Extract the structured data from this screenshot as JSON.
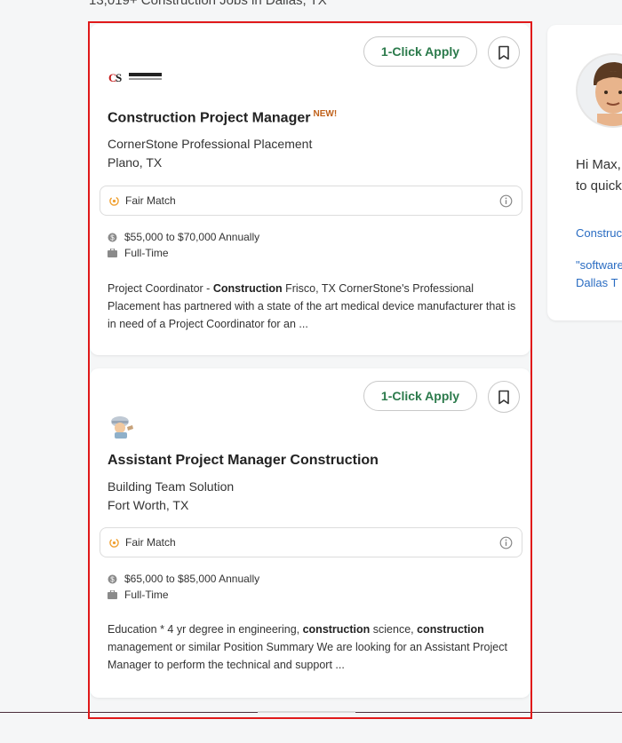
{
  "header": {
    "results_count": "13,019+ Construction Jobs in Dallas, TX"
  },
  "jobs": [
    {
      "apply_label": "1-Click Apply",
      "title": "Construction Project Manager",
      "new_badge": "NEW!",
      "company": "CornerStone Professional Placement",
      "location": "Plano, TX",
      "match_label": "Fair Match",
      "salary": "$55,000 to $70,000 Annually",
      "job_type": "Full-Time",
      "desc": [
        "Project Coordinator - ",
        "Construction",
        " Frisco, TX CornerStone's Professional Placement has partnered with a state of the art medical device manufacturer that is in need of a Project Coordinator for an ..."
      ],
      "logo_text": "CornerStone"
    },
    {
      "apply_label": "1-Click Apply",
      "title": "Assistant Project Manager Construction",
      "company": "Building Team Solution",
      "location": "Fort Worth, TX",
      "match_label": "Fair Match",
      "salary": "$65,000 to $85,000 Annually",
      "job_type": "Full-Time",
      "desc": [
        "Education * 4 yr degree in engineering, ",
        "construction",
        " science, ",
        "construction",
        " management or similar Position Summary We are looking for an Assistant Project Manager to perform the technical and support ..."
      ]
    }
  ],
  "sidebar": {
    "greeting_line1": "Hi Max,",
    "greeting_line2": "to quick",
    "link1": "Construc",
    "link2_line1": "\"software",
    "link2_line2": "Dallas T"
  },
  "colors": {
    "accent_green": "#2b7a4b",
    "link_blue": "#2a6cc2",
    "new_orange": "#c0611a",
    "frame_red": "#e0191a"
  }
}
